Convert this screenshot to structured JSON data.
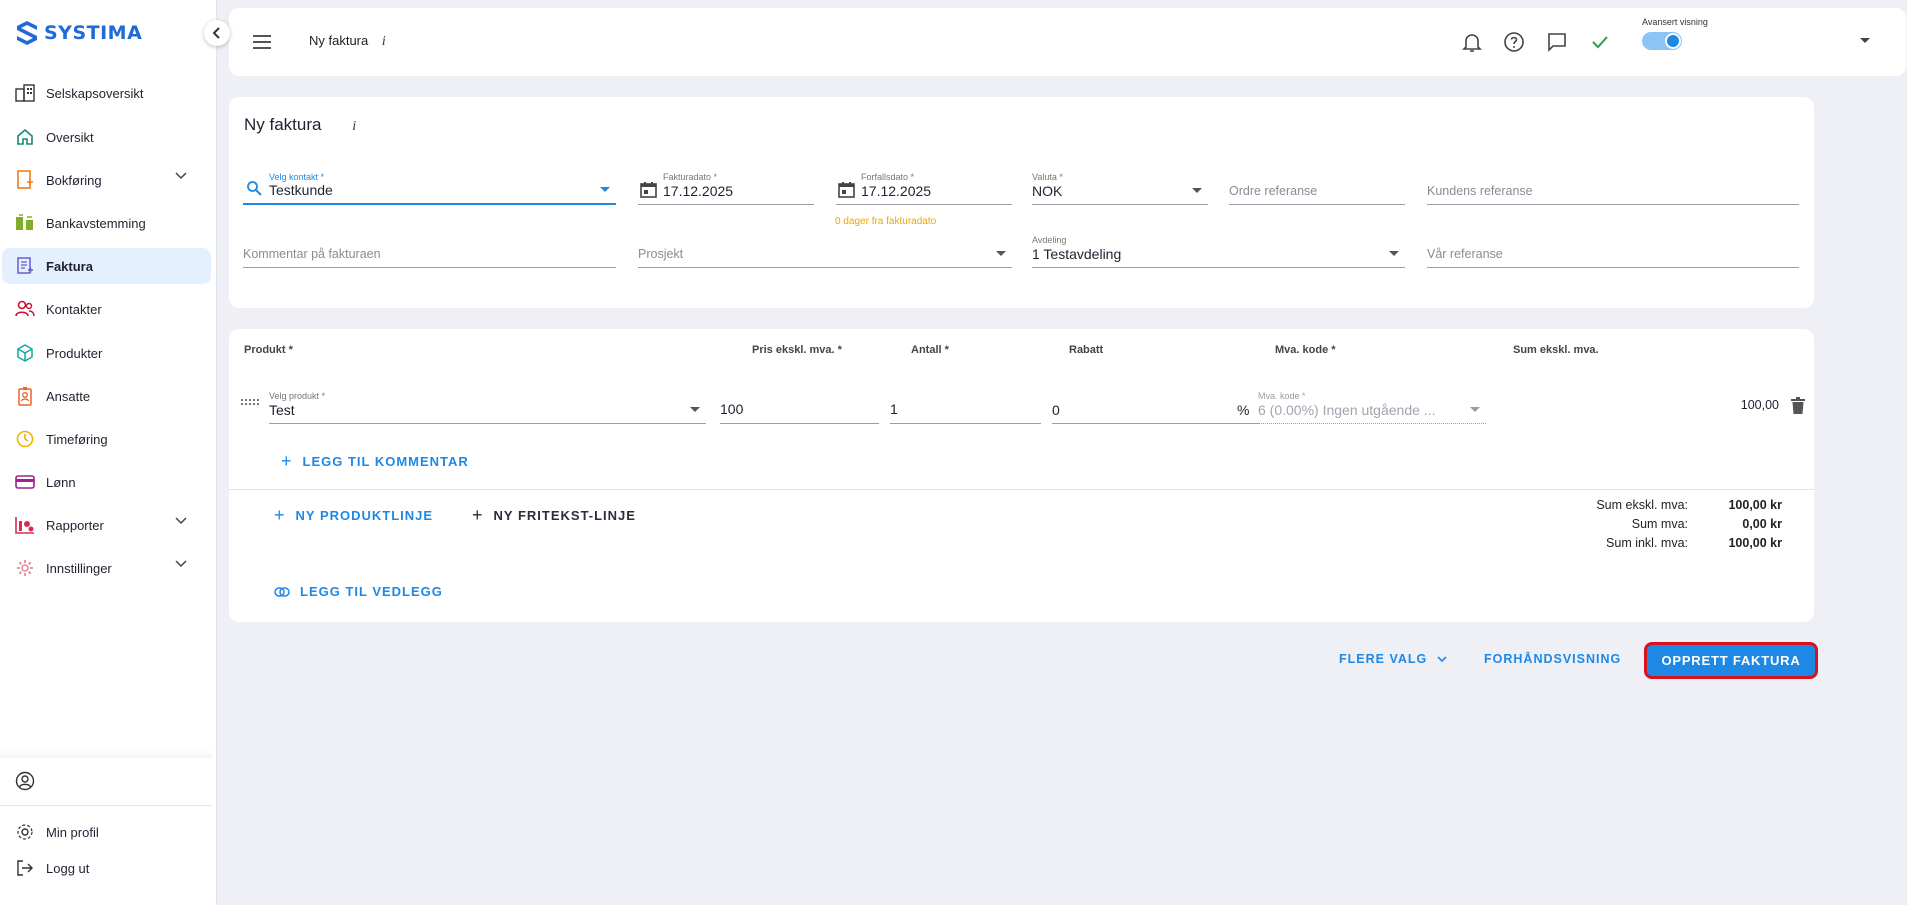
{
  "brand": {
    "name": "SYSTIMA",
    "color": "#1e6ad8"
  },
  "sidebar": {
    "items": [
      {
        "label": "Selskapsoversikt",
        "icon": "buildings-icon"
      },
      {
        "label": "Oversikt",
        "icon": "home-icon"
      },
      {
        "label": "Bokføring",
        "icon": "ledger-icon",
        "expandable": true
      },
      {
        "label": "Bankavstemming",
        "icon": "bank-icon"
      },
      {
        "label": "Faktura",
        "icon": "invoice-icon",
        "active": true
      },
      {
        "label": "Kontakter",
        "icon": "contacts-icon"
      },
      {
        "label": "Produkter",
        "icon": "box-icon"
      },
      {
        "label": "Ansatte",
        "icon": "badge-icon"
      },
      {
        "label": "Timeføring",
        "icon": "clock-icon"
      },
      {
        "label": "Lønn",
        "icon": "card-icon"
      },
      {
        "label": "Rapporter",
        "icon": "reports-icon",
        "expandable": true
      },
      {
        "label": "Innstillinger",
        "icon": "gear-icon",
        "expandable": true
      }
    ],
    "footer": {
      "profile": "Min profil",
      "logout": "Logg ut"
    }
  },
  "topbar": {
    "title": "Ny faktura",
    "info": "i",
    "toggle_label": "Avansert visning",
    "toggle_on": true
  },
  "invoice": {
    "heading": "Ny faktura",
    "info": "i",
    "contact": {
      "label": "Velg kontakt *",
      "value": "Testkunde"
    },
    "invoice_date": {
      "label": "Fakturadato *",
      "value": "17.12.2025"
    },
    "due_date": {
      "label": "Forfallsdato *",
      "value": "17.12.2025",
      "hint": "0 dager fra fakturadato"
    },
    "currency": {
      "label": "Valuta *",
      "value": "NOK"
    },
    "order_ref": {
      "placeholder": "Ordre referanse"
    },
    "customer_ref": {
      "placeholder": "Kundens referanse"
    },
    "comment": {
      "placeholder": "Kommentar på fakturaen"
    },
    "project": {
      "placeholder": "Prosjekt"
    },
    "department": {
      "label": "Avdeling",
      "value": "1 Testavdeling"
    },
    "our_ref": {
      "placeholder": "Vår referanse"
    }
  },
  "lines": {
    "headers": {
      "product": "Produkt *",
      "price": "Pris ekskl. mva. *",
      "qty": "Antall *",
      "discount": "Rabatt",
      "vat": "Mva. kode *",
      "sum": "Sum ekskl. mva."
    },
    "row": {
      "product_label": "Velg produkt *",
      "product": "Test",
      "price": "100",
      "qty": "1",
      "discount": "0",
      "percent": "%",
      "vat_label": "Mva. kode *",
      "vat": "6 (0.00%) Ingen utgående ...",
      "sum": "100,00"
    },
    "add_comment": "LEGG TIL KOMMENTAR",
    "new_product_line": "NY PRODUKTLINJE",
    "new_text_line": "NY FRITEKST-LINJE",
    "add_attachment": "LEGG TIL VEDLEGG"
  },
  "totals": [
    {
      "label": "Sum ekskl. mva:",
      "value": "100,00 kr"
    },
    {
      "label": "Sum mva:",
      "value": "0,00 kr"
    },
    {
      "label": "Sum inkl. mva:",
      "value": "100,00 kr"
    }
  ],
  "actions": {
    "more": "FLERE VALG",
    "preview": "FORHÅNDSVISNING",
    "create": "OPPRETT FAKTURA"
  }
}
